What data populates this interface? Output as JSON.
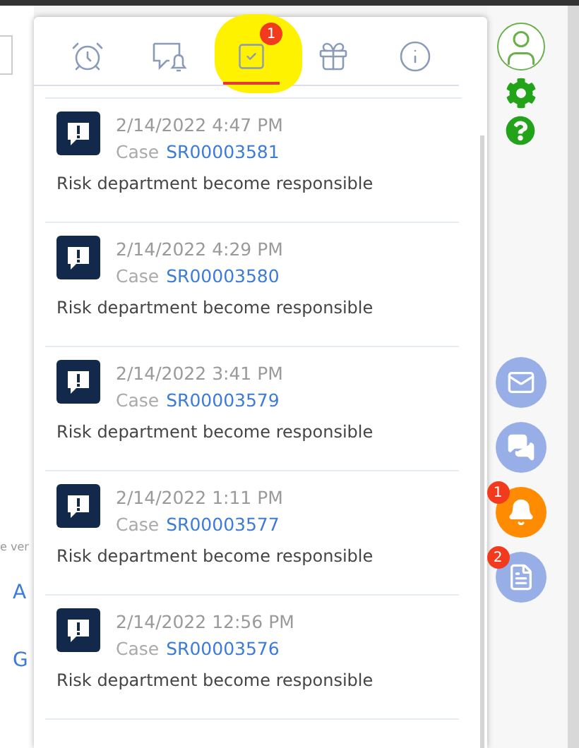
{
  "left_page": [
    {
      "kind": "caption",
      "text": "e ver"
    },
    {
      "kind": "link",
      "text": "A"
    },
    {
      "kind": "link",
      "text": "G"
    }
  ],
  "tabs": [
    {
      "kind": "alarm",
      "selected": false,
      "highlighted": false
    },
    {
      "kind": "chat",
      "selected": false,
      "highlighted": false
    },
    {
      "kind": "task",
      "selected": true,
      "highlighted": true,
      "badge": "1"
    },
    {
      "kind": "gift",
      "selected": false,
      "highlighted": false
    },
    {
      "kind": "info",
      "selected": false,
      "highlighted": false
    }
  ],
  "notifications": [
    {
      "date": "2/14/2022 4:47 PM",
      "case_label": "Case",
      "case_number": "SR00003581",
      "message": "Risk department become responsible"
    },
    {
      "date": "2/14/2022 4:29 PM",
      "case_label": "Case",
      "case_number": "SR00003580",
      "message": "Risk department become responsible"
    },
    {
      "date": "2/14/2022 3:41 PM",
      "case_label": "Case",
      "case_number": "SR00003579",
      "message": "Risk department become responsible"
    },
    {
      "date": "2/14/2022 1:11 PM",
      "case_label": "Case",
      "case_number": "SR00003577",
      "message": "Risk department become responsible"
    },
    {
      "date": "2/14/2022 12:56 PM",
      "case_label": "Case",
      "case_number": "SR00003576",
      "message": "Risk department become responsible"
    }
  ],
  "rail": {
    "top": [
      {
        "kind": "profile"
      },
      {
        "kind": "settings"
      },
      {
        "kind": "help"
      }
    ],
    "buttons": [
      {
        "kind": "mail",
        "active": false
      },
      {
        "kind": "chat",
        "active": false
      },
      {
        "kind": "bell",
        "active": true,
        "badge": "1"
      },
      {
        "kind": "feed",
        "active": false,
        "badge": "2"
      }
    ]
  }
}
